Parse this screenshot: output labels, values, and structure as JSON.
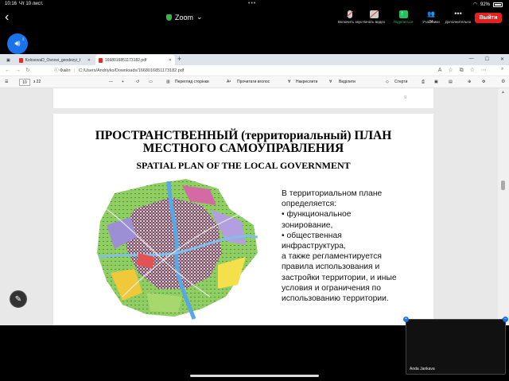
{
  "statusbar": {
    "time": "10:16",
    "date": "Чт 10 лист.",
    "battery": "92%"
  },
  "zoom": {
    "title": "Zoom",
    "controls": [
      {
        "label": "Включить звук",
        "icon": "mic-muted-icon"
      },
      {
        "label": "Начать видео",
        "icon": "video-off-icon"
      },
      {
        "label": "Поделиться",
        "icon": "share-screen-icon"
      },
      {
        "label": "Участники",
        "icon": "participants-icon",
        "count": "34"
      },
      {
        "label": "Дополнительно",
        "icon": "more-icon"
      }
    ],
    "leave_label": "Выйти"
  },
  "browser": {
    "tabs": [
      {
        "label": "KolosovaD_Osnovi_geodezyi_K"
      },
      {
        "label": "1668016851173182.pdf"
      }
    ],
    "address_prefix": "Файл",
    "address": "C:/Users/Andriyko/Downloads/1668016851173182.pdf"
  },
  "pdf_toolbar": {
    "page_current": "10",
    "page_total": "з 22",
    "view_label": "Перегляд сторінки",
    "read_aloud_label": "Прочитати вголос",
    "draw_label": "Накреслити",
    "highlight_label": "Виділити",
    "erase_label": "Стерти"
  },
  "pdf": {
    "prev_page_number": "9",
    "title_ru_line1": "ПРОСТРАНСТВЕННЫЙ (территориальный) ПЛАН",
    "title_ru_line2": "МЕСТНОГО САМОУПРАВЛЕНИЯ",
    "title_en": "SPATIAL PLAN OF THE LOCAL GOVERNMENT",
    "body": "В территориальном плане\nопределяется:\n• функциональное\nзонирование,\n• общественная\nинфраструктура,\n а также регламентируется\nправила использования и\nзастройки территории,  и иные\nусловия и ограничения по\nиспользованию территории."
  },
  "video": {
    "participant_name": "Anda Jankava"
  },
  "colors": {
    "leave": "#e5211d",
    "share": "#27c160",
    "accent": "#1a73e8"
  }
}
